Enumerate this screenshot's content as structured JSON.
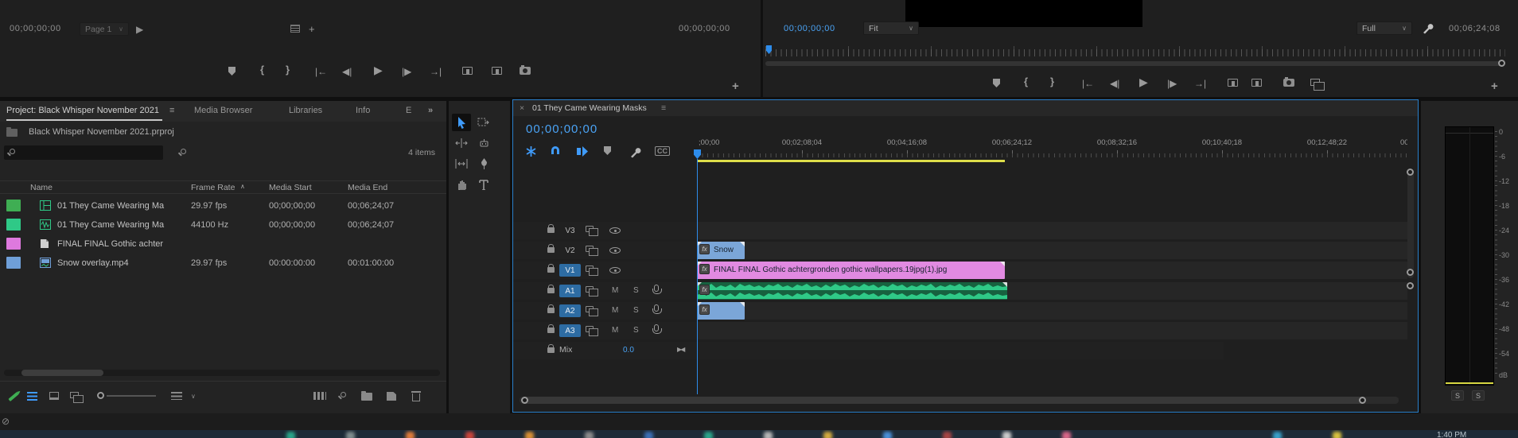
{
  "icons": {
    "menu": "≡",
    "chevron": "∨",
    "close": "×",
    "overflow": "»",
    "play": "▶",
    "step_back": "◀|",
    "step_fwd": "|▶",
    "go_in": "|←",
    "go_out": "→|",
    "mark_in": "{",
    "mark_out": "}",
    "plus": "+",
    "sort_asc": "∧",
    "sync_off": "⊘",
    "mix_keyframe": "▶◀"
  },
  "source_monitor": {
    "timecode_in": "00;00;00;00",
    "page_label": "Page 1",
    "timecode_duration": "00;00;00;00"
  },
  "program_monitor": {
    "timecode": "00;00;00;00",
    "zoom_level": "Fit",
    "playback_resolution": "Full",
    "duration": "00;06;24;08"
  },
  "project_panel": {
    "tab_active": "Project: Black Whisper November 2021",
    "tabs": [
      "Media Browser",
      "Libraries",
      "Info",
      "E"
    ],
    "project_file": "Black Whisper November 2021.prproj",
    "item_count": "4 items",
    "columns": {
      "name": "Name",
      "frame_rate": "Frame Rate",
      "media_start": "Media Start",
      "media_end": "Media End"
    },
    "rows": [
      {
        "color": "#3fae53",
        "name": "01 They Came Wearing Ma",
        "frame_rate": "29.97 fps",
        "media_start": "00;00;00;00",
        "media_end": "00;06;24;07"
      },
      {
        "color": "#2fc987",
        "name": "01 They Came Wearing Ma",
        "frame_rate": "44100 Hz",
        "media_start": "00;00;00;00",
        "media_end": "00;06;24;07"
      },
      {
        "color": "#de79de",
        "name": "FINAL FINAL Gothic achter",
        "frame_rate": "",
        "media_start": "",
        "media_end": ""
      },
      {
        "color": "#6f9fd8",
        "name": "Snow overlay.mp4",
        "frame_rate": "29.97 fps",
        "media_start": "00:00:00:00",
        "media_end": "00:01:00:00"
      }
    ]
  },
  "timeline": {
    "tab_title": "01 They Came Wearing Masks",
    "timecode": "00;00;00;00",
    "cc_label": "CC",
    "fx_badge": "fx",
    "ruler_labels": [
      ";00;00",
      "00;02;08;04",
      "00;04;16;08",
      "00;06;24;12",
      "00;08;32;16",
      "00;10;40;18",
      "00;12;48;22",
      "00;"
    ],
    "video_tracks": [
      {
        "label": "V3",
        "targeted": false
      },
      {
        "label": "V2",
        "targeted": false
      },
      {
        "label": "V1",
        "targeted": true
      }
    ],
    "audio_tracks": [
      {
        "label": "A1"
      },
      {
        "label": "A2"
      },
      {
        "label": "A3"
      }
    ],
    "mute_label": "M",
    "solo_label": "S",
    "mix_label": "Mix",
    "mix_value": "0.0",
    "clips": {
      "snow": {
        "label": "Snow",
        "color": "#7ba6d8"
      },
      "gothic": {
        "label": "FINAL FINAL Gothic achtergronden gothic wallpapers.19jpg(1).jpg",
        "color": "#e18ae1"
      },
      "audio1": {
        "color": "#17613f"
      },
      "audio2": {
        "color": "#7ba6d8"
      }
    }
  },
  "audio_meter": {
    "ticks": [
      "0",
      "-6",
      "-12",
      "-18",
      "-24",
      "-30",
      "-36",
      "-42",
      "-48",
      "-54",
      "dB"
    ],
    "solo": "S"
  },
  "taskbar": {
    "clock": "1:40 PM"
  }
}
